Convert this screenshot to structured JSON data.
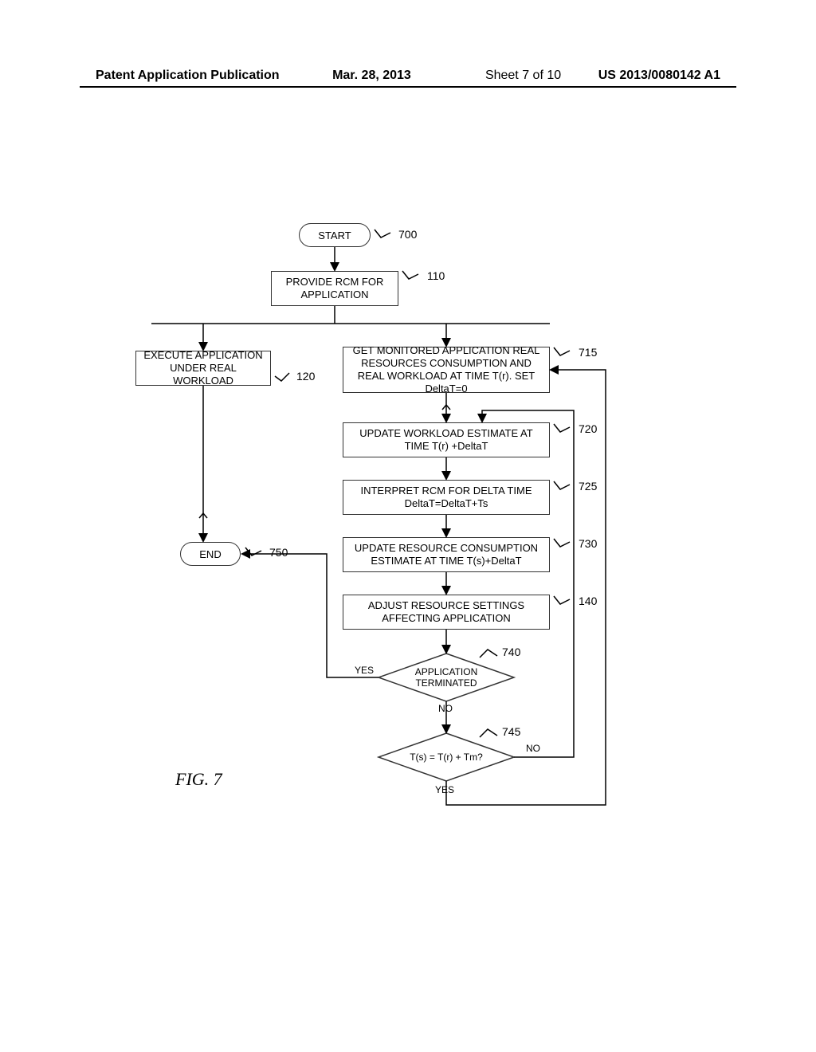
{
  "header": {
    "publication": "Patent Application Publication",
    "date": "Mar. 28, 2013",
    "sheet": "Sheet 7 of 10",
    "docnum": "US 2013/0080142 A1"
  },
  "figure_label": "FIG. 7",
  "nodes": {
    "start": "START",
    "end": "END",
    "n110": "PROVIDE RCM FOR APPLICATION",
    "n120": "EXECUTE APPLICATION UNDER REAL WORKLOAD",
    "n715": "GET MONITORED APPLICATION REAL RESOURCES CONSUMPTION AND REAL WORKLOAD AT TIME T(r). SET DeltaT=0",
    "n720": "UPDATE WORKLOAD ESTIMATE AT TIME T(r) +DeltaT",
    "n725": "INTERPRET RCM FOR DELTA TIME DeltaT=DeltaT+Ts",
    "n730": "UPDATE RESOURCE CONSUMPTION ESTIMATE AT TIME T(s)+DeltaT",
    "n140": "ADJUST RESOURCE SETTINGS AFFECTING APPLICATION",
    "d740": "APPLICATION TERMINATED",
    "d745": "T(s) = T(r) + Tm?"
  },
  "refs": {
    "r700": "700",
    "r110": "110",
    "r120": "120",
    "r715": "715",
    "r720": "720",
    "r725": "725",
    "r730": "730",
    "r140": "140",
    "r740": "740",
    "r745": "745",
    "r750": "750"
  },
  "branches": {
    "yes": "YES",
    "no": "NO"
  }
}
